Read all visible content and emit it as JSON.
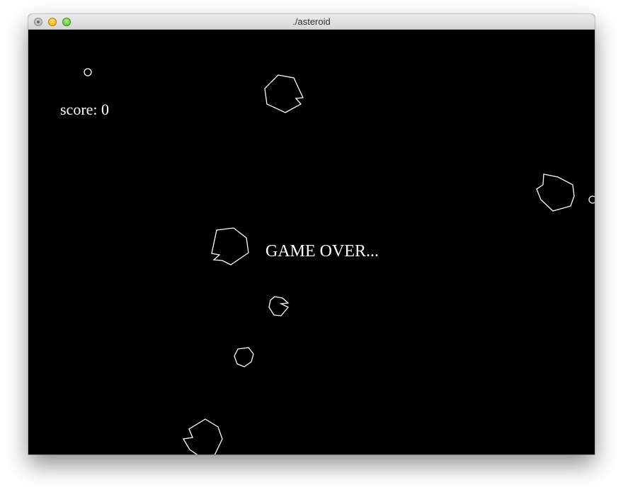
{
  "window": {
    "title": "./asteroid"
  },
  "game": {
    "score_text": "score: 0",
    "status_text": "GAME OVER...",
    "background_color": "#000000",
    "stroke_color": "#ffffff"
  }
}
